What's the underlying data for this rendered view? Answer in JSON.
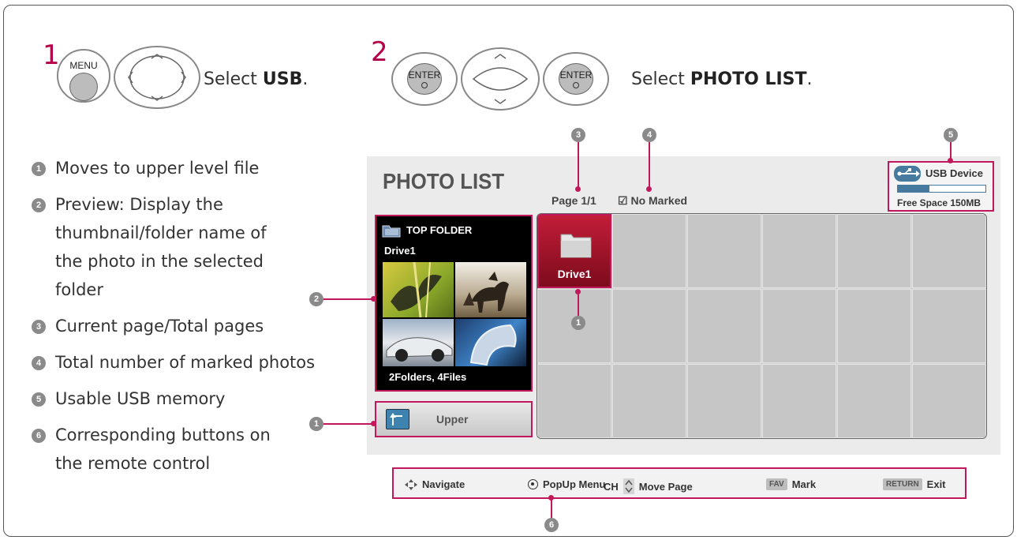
{
  "steps": [
    {
      "number": "1",
      "select_prefix": "Select ",
      "select_target": "USB",
      "select_suffix": "."
    },
    {
      "number": "2",
      "select_prefix": "Select ",
      "select_target": "PHOTO LIST",
      "select_suffix": "."
    }
  ],
  "remote": {
    "menu_label": "MENU",
    "enter_label": "ENTER"
  },
  "legend": [
    {
      "num": "1",
      "text": "Moves to upper level file"
    },
    {
      "num": "2",
      "text": "Preview: Display the thumbnail/folder name of the photo in the selected folder"
    },
    {
      "num": "3",
      "text": "Current page/Total pages"
    },
    {
      "num": "4",
      "text": "Total number of marked photos"
    },
    {
      "num": "5",
      "text": "Usable USB memory"
    },
    {
      "num": "6",
      "text": "Corresponding buttons on the remote control"
    }
  ],
  "screen": {
    "title": "PHOTO LIST",
    "page_info": "Page 1/1",
    "marked_info": "No Marked",
    "usb": {
      "label": "USB Device",
      "free_space": "Free Space 150MB",
      "used_fraction": 0.36,
      "color": "#477a9f"
    },
    "preview": {
      "folder_label": "TOP FOLDER",
      "drive_label": "Drive1",
      "count_label": "2Folders, 4Files"
    },
    "upper_label": "Upper",
    "grid": {
      "selected_label": "Drive1",
      "rows": 3,
      "cols": 6
    }
  },
  "bottom_bar": {
    "navigate": "Navigate",
    "popup": "PopUp Menu",
    "ch": "CH",
    "move_page": "Move Page",
    "fav_key": "FAV",
    "mark": "Mark",
    "return_key": "RETURN",
    "exit": "Exit"
  },
  "callouts": [
    "1",
    "2",
    "3",
    "4",
    "5",
    "6"
  ],
  "colors": {
    "accent": "#c2185b",
    "step_number": "#b5004a",
    "selected_cell": "#a0132b"
  }
}
